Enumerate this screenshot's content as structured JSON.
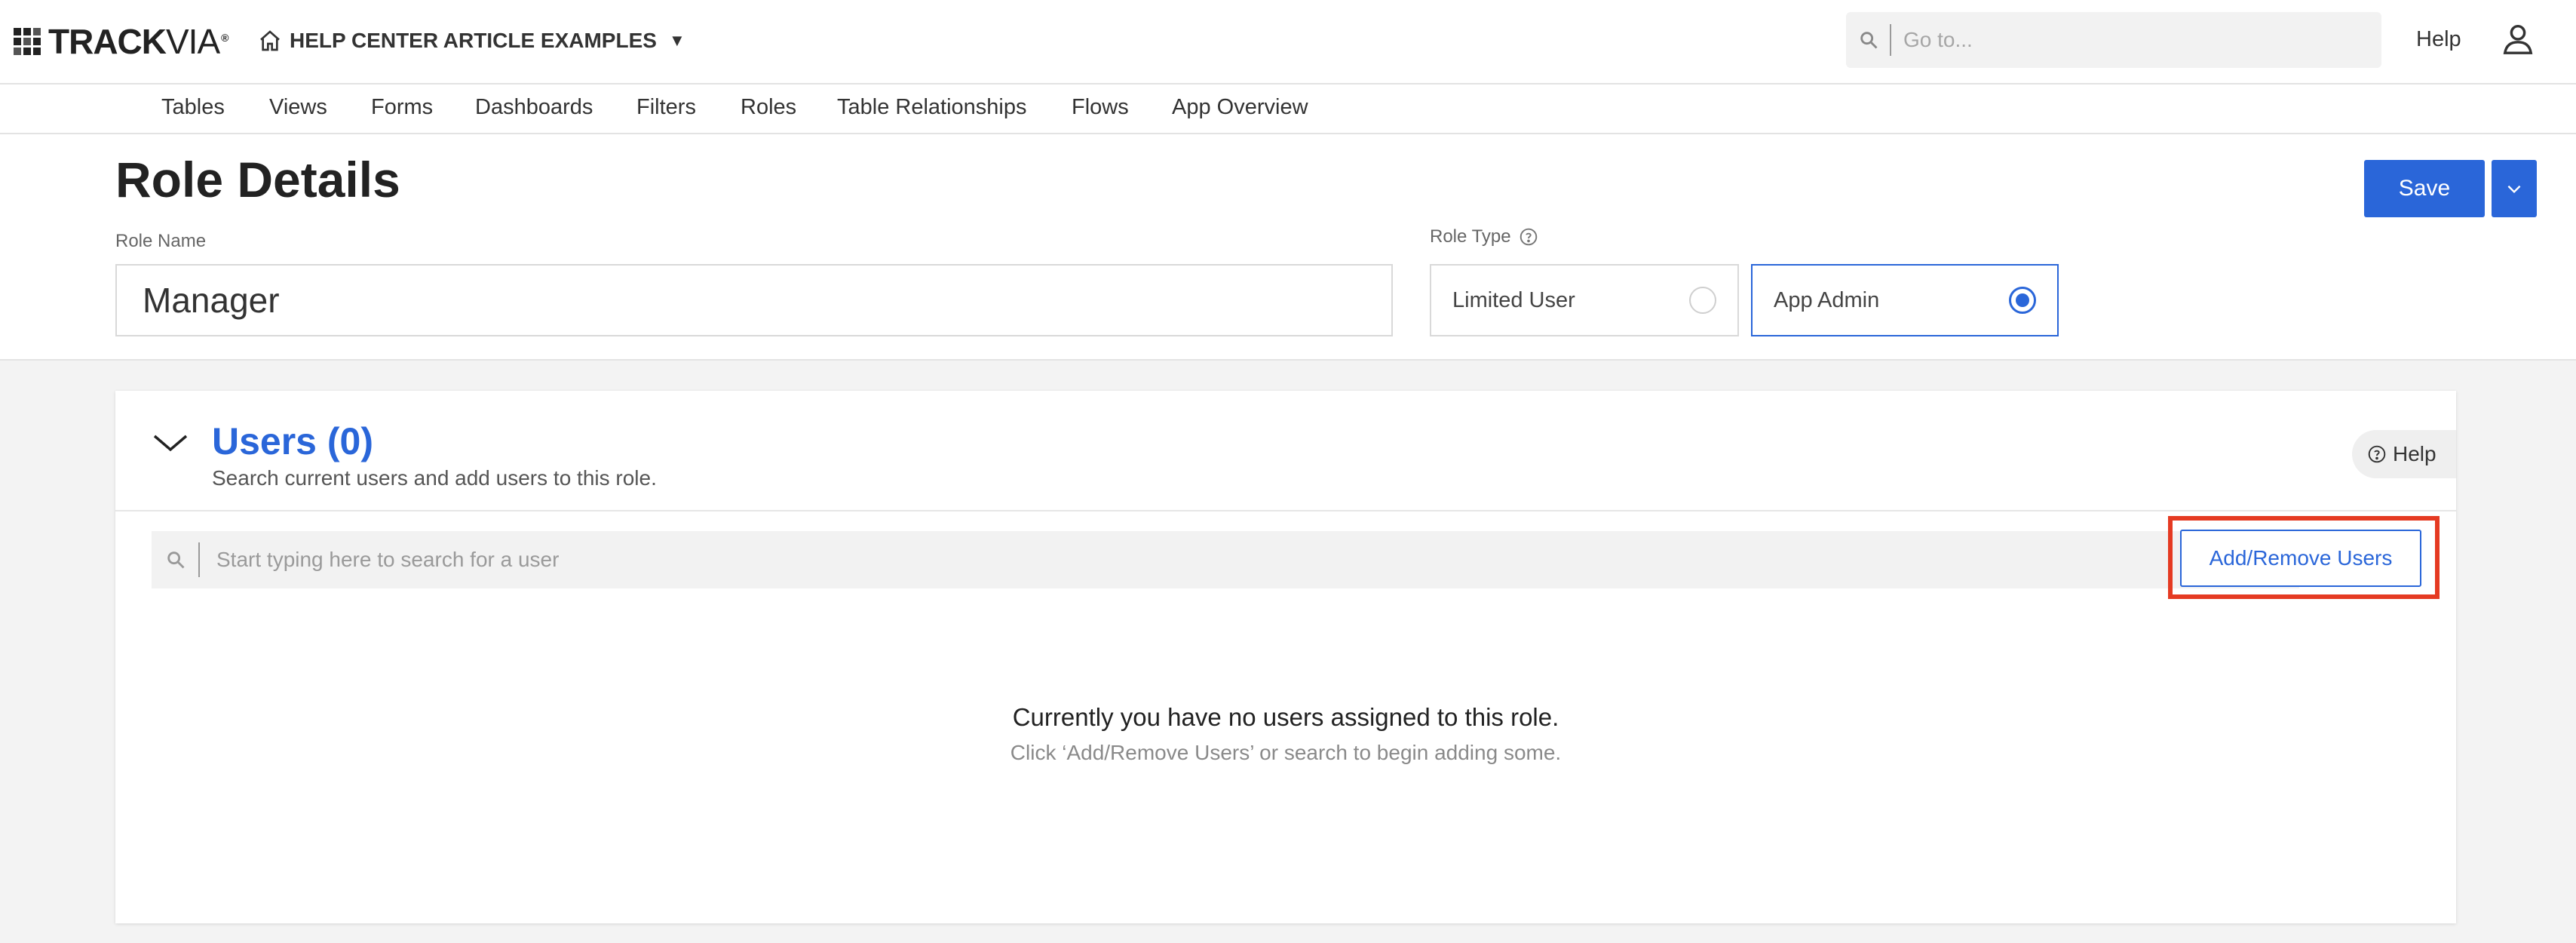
{
  "brand": {
    "logo_bold": "TRACK",
    "logo_light": "VIA",
    "logo_tm": "®"
  },
  "header": {
    "app_name": "HELP CENTER ARTICLE EXAMPLES",
    "goto_placeholder": "Go to...",
    "help_label": "Help"
  },
  "nav": {
    "tabs": [
      "Tables",
      "Views",
      "Forms",
      "Dashboards",
      "Filters",
      "Roles",
      "Table Relationships",
      "Flows",
      "App Overview"
    ]
  },
  "role": {
    "page_title": "Role Details",
    "save_label": "Save",
    "name_label": "Role Name",
    "name_value": "Manager",
    "type_label": "Role Type",
    "options": [
      {
        "label": "Limited User",
        "selected": false
      },
      {
        "label": "App Admin",
        "selected": true
      }
    ]
  },
  "users": {
    "title": "Users (0)",
    "subtitle": "Search current users and add users to this role.",
    "help_label": "Help",
    "search_placeholder": "Start typing here to search for a user",
    "add_remove_label": "Add/Remove Users",
    "empty_title": "Currently you have no users assigned to this role.",
    "empty_subtitle": "Click ‘Add/Remove Users’ or search to begin adding some."
  },
  "colors": {
    "accent": "#2a66d9",
    "highlight": "#e53a22"
  }
}
